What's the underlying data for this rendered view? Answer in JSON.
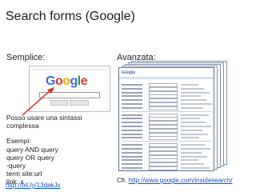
{
  "slide": {
    "title": "Search forms (Google)",
    "simple_label": "Semplice:",
    "advanced_label": "Avanzata:",
    "notes": {
      "intro_line1": "Posso usare una sintassi",
      "intro_line2": "complessa",
      "examples_header": "Esempi:",
      "examples": [
        "query AND query",
        "query OR query",
        "-query",
        "term site:url",
        "link: x"
      ]
    },
    "left_link": "http://bit.ly/13dakJx",
    "cfr_prefix": "Cfr. ",
    "cfr_link": "http://www.google.com/insidesearch/"
  },
  "simple_search": {
    "logo_letters": [
      "G",
      "o",
      "o",
      "g",
      "l",
      "e"
    ],
    "logo_colors": [
      "#3b6fd8",
      "#d7382c",
      "#f2b100",
      "#3b6fd8",
      "#2d9a47",
      "#d7382c"
    ]
  },
  "advanced_search": {
    "logo_text": "Google",
    "stack_count": 5
  },
  "colors": {
    "arrow": "#e0301e",
    "link": "#1155cc"
  }
}
